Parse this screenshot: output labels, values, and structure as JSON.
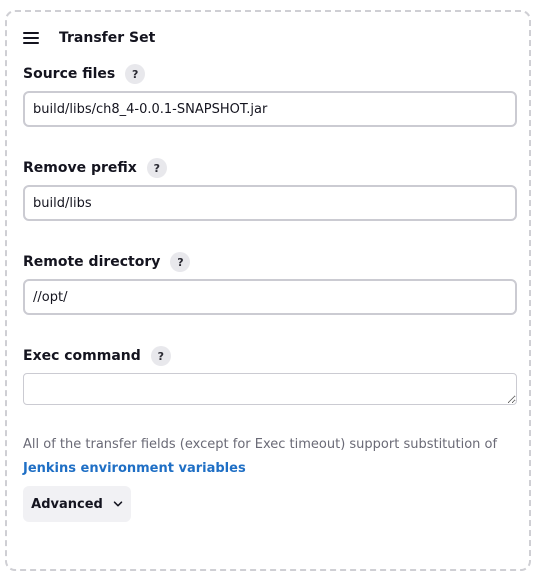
{
  "section": {
    "title": "Transfer Set",
    "drag_icon": "hamburger-icon"
  },
  "fields": {
    "source_files": {
      "label": "Source files",
      "help": "?",
      "value": "build/libs/ch8_4-0.0.1-SNAPSHOT.jar"
    },
    "remove_prefix": {
      "label": "Remove prefix",
      "help": "?",
      "value": "build/libs"
    },
    "remote_directory": {
      "label": "Remote directory",
      "help": "?",
      "value": "//opt/"
    },
    "exec_command": {
      "label": "Exec command",
      "help": "?",
      "value": ""
    }
  },
  "note": {
    "text": "All of the transfer fields (except for Exec timeout) support substitution of",
    "link": "Jenkins environment variables"
  },
  "advanced": {
    "label": "Advanced",
    "icon": "chevron-down-icon"
  },
  "colors": {
    "link": "#1f6fc5",
    "border": "#cbcbd2",
    "muted_text": "#6a6a76",
    "panel_border": "#cfcfd4"
  }
}
